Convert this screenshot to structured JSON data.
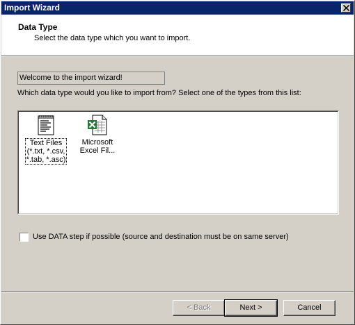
{
  "window": {
    "title": "Import Wizard"
  },
  "header": {
    "title": "Data Type",
    "subtitle": "Select the data type which you want to import."
  },
  "main": {
    "welcome": "Welcome to the import wizard!",
    "question": "Which data type would you like to import from?  Select one of the types from this list:",
    "data_types": [
      {
        "label_lines": [
          "Text Files",
          "(*.txt, *.csv,",
          "*.tab, *.asc)"
        ],
        "icon": "text-file-icon",
        "focused": true
      },
      {
        "label_lines": [
          "Microsoft",
          "Excel Fil..."
        ],
        "icon": "excel-file-icon",
        "focused": false
      }
    ],
    "checkbox": {
      "label": "Use DATA step if possible (source and destination must be on same server)",
      "checked": false
    }
  },
  "buttons": {
    "back": "< Back",
    "next": "Next >",
    "cancel": "Cancel"
  },
  "colors": {
    "titlebar": "#0a246a",
    "face": "#d4d0c8"
  }
}
